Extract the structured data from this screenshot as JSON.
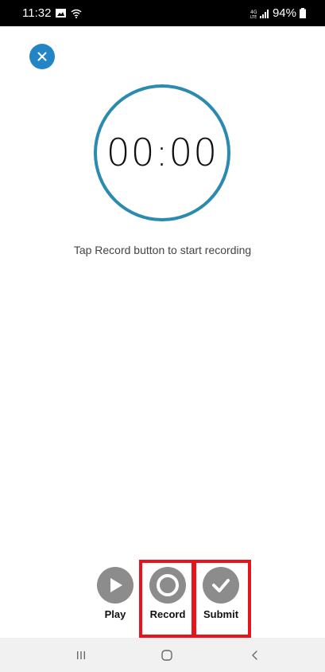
{
  "status_bar": {
    "time": "11:32",
    "battery_label": "94%",
    "icons": [
      "gallery-icon",
      "wifi-icon",
      "lte-signal-icon",
      "battery-icon"
    ]
  },
  "recorder": {
    "timer": "00:00",
    "hint": "Tap Record button to start recording"
  },
  "controls": {
    "play_label": "Play",
    "record_label": "Record",
    "submit_label": "Submit"
  },
  "colors": {
    "accent": "#2385c6",
    "ring": "#2a8ab0",
    "control_gray": "#8c8c8c",
    "highlight_red": "#e8141c"
  },
  "nav": {
    "icons": [
      "recents-icon",
      "home-icon",
      "back-icon"
    ]
  }
}
